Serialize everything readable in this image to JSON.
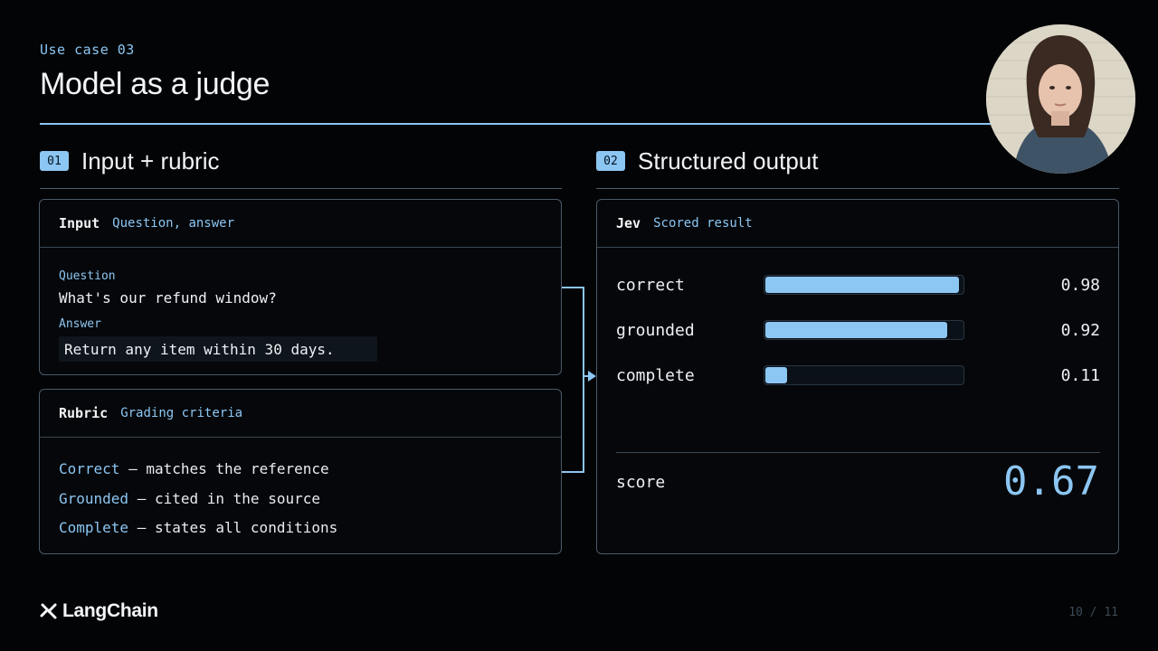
{
  "header": {
    "eyebrow": "Use case 03",
    "title": "Model as a judge"
  },
  "left_section": {
    "badge": "01",
    "title": "Input + rubric",
    "input_card": {
      "heading": "Input",
      "subheading": "Question, answer",
      "question_label": "Question",
      "question_value": "What's our refund window?",
      "answer_label": "Answer",
      "answer_value": "Return any item within 30 days."
    },
    "rubric_card": {
      "heading": "Rubric",
      "subheading": "Grading criteria",
      "criteria": [
        {
          "keyword": "Correct",
          "text": " – matches the reference"
        },
        {
          "keyword": "Grounded",
          "text": " – cited in the source"
        },
        {
          "keyword": "Complete",
          "text": " – states all conditions"
        }
      ]
    }
  },
  "right_section": {
    "badge": "02",
    "title": "Structured output",
    "output_card": {
      "heading": "Jev",
      "subheading": "Scored result",
      "metrics": [
        {
          "name": "correct",
          "value": "0.98",
          "fraction": 0.98
        },
        {
          "name": "grounded",
          "value": "0.92",
          "fraction": 0.92
        },
        {
          "name": "complete",
          "value": "0.11",
          "fraction": 0.11
        }
      ],
      "score_label": "score",
      "score_value": "0.67"
    }
  },
  "footer": {
    "logo_text": "LangChain",
    "page_indicator": "10 / 11"
  },
  "colors": {
    "accent": "#8cc6f2",
    "background": "#030406",
    "border": "#4c5a68"
  }
}
